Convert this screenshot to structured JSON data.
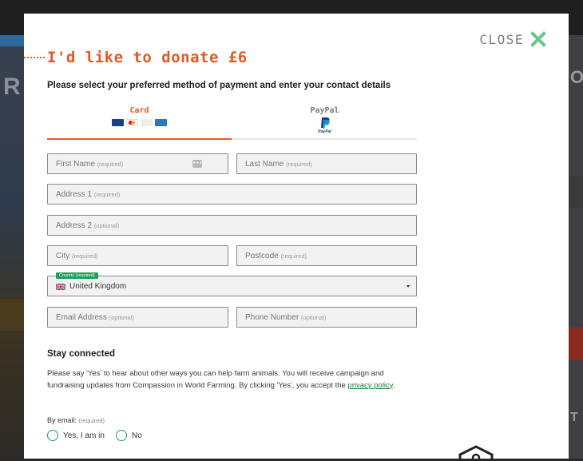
{
  "backdrop": {
    "left_letter": "R",
    "right_letter": "O",
    "right_letter2": "T"
  },
  "modal": {
    "close": {
      "label": "CLOSE",
      "icon": "close-icon",
      "icon_color": "#6cc48a"
    },
    "title": "I'd like to donate £6",
    "subtitle": "Please select your preferred method of payment and enter your contact details",
    "accent_color": "#e05a26",
    "tabs": [
      {
        "label": "Card",
        "selected": true,
        "icons": [
          "visa-icon",
          "mastercard-icon",
          "maestro-icon",
          "amex-icon"
        ]
      },
      {
        "label": "PayPal",
        "selected": false,
        "icons": [
          "paypal-icon"
        ],
        "sub_label": "PayPal"
      }
    ],
    "form": {
      "first_name": {
        "label": "First Name",
        "hint": "(required)",
        "value": ""
      },
      "last_name": {
        "label": "Last Name",
        "hint": "(required)",
        "value": ""
      },
      "address1": {
        "label": "Address 1",
        "hint": "(required)",
        "value": ""
      },
      "address2": {
        "label": "Address 2",
        "hint": "(optional)",
        "value": ""
      },
      "city": {
        "label": "City",
        "hint": "(required)",
        "value": ""
      },
      "postcode": {
        "label": "Postcode",
        "hint": "(required)",
        "value": ""
      },
      "country": {
        "badge": "Country (required)",
        "value": "United Kingdom",
        "flag": "uk-flag-icon"
      },
      "email": {
        "label": "Email Address",
        "hint": "(optional)",
        "value": ""
      },
      "phone": {
        "label": "Phone Number",
        "hint": "(optional)",
        "value": ""
      }
    },
    "stay_connected": {
      "heading": "Stay connected",
      "consent_text": "Please say 'Yes' to hear about other ways you can help farm animals. You will receive campaign and fundraising updates from Compassion in World Farming. By clicking 'Yes', you accept the ",
      "privacy_link": "privacy policy",
      "consent_end": ".",
      "by_email_label": "By email:",
      "by_email_hint": "(required)",
      "options": [
        "Yes, I am in",
        "No"
      ],
      "radio_color": "#1ea05a"
    }
  }
}
